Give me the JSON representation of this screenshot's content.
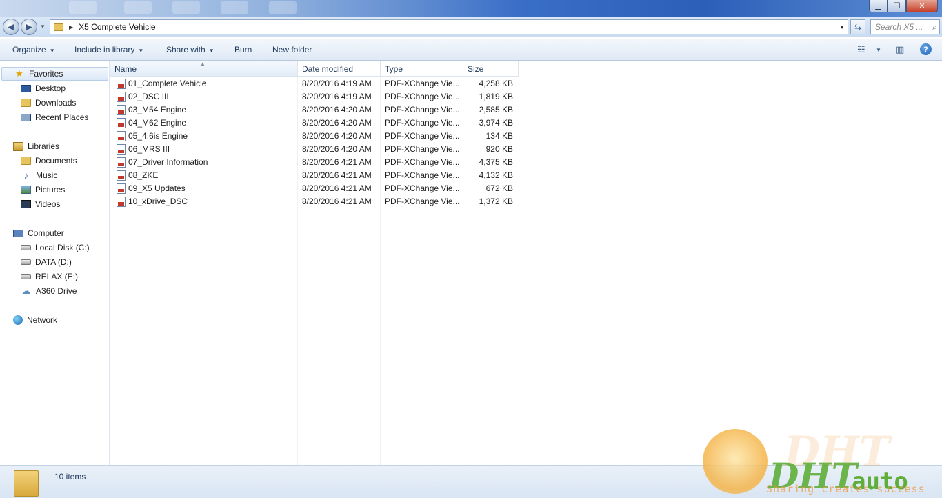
{
  "window": {
    "minimize_glyph": "▁",
    "maximize_glyph": "❐",
    "close_glyph": "✕"
  },
  "address": {
    "path": "X5 Complete Vehicle",
    "search_placeholder": "Search X5 ..."
  },
  "toolbar": {
    "organize": "Organize",
    "include_in_library": "Include in library",
    "share_with": "Share with",
    "burn": "Burn",
    "new_folder": "New folder",
    "help": "?"
  },
  "nav": {
    "favorites": "Favorites",
    "desktop": "Desktop",
    "downloads": "Downloads",
    "recent_places": "Recent Places",
    "libraries": "Libraries",
    "documents": "Documents",
    "music": "Music",
    "pictures": "Pictures",
    "videos": "Videos",
    "computer": "Computer",
    "local_disk": "Local Disk (C:)",
    "data_d": "DATA (D:)",
    "relax_e": "RELAX (E:)",
    "a360": "A360 Drive",
    "network": "Network"
  },
  "columns": {
    "name": "Name",
    "date_modified": "Date modified",
    "type": "Type",
    "size": "Size"
  },
  "files": [
    {
      "name": "01_Complete Vehicle",
      "date": "8/20/2016 4:19 AM",
      "type": "PDF-XChange Vie...",
      "size": "4,258 KB"
    },
    {
      "name": "02_DSC III",
      "date": "8/20/2016 4:19 AM",
      "type": "PDF-XChange Vie...",
      "size": "1,819 KB"
    },
    {
      "name": "03_M54 Engine",
      "date": "8/20/2016 4:20 AM",
      "type": "PDF-XChange Vie...",
      "size": "2,585 KB"
    },
    {
      "name": "04_M62 Engine",
      "date": "8/20/2016 4:20 AM",
      "type": "PDF-XChange Vie...",
      "size": "3,974 KB"
    },
    {
      "name": "05_4.6is Engine",
      "date": "8/20/2016 4:20 AM",
      "type": "PDF-XChange Vie...",
      "size": "134 KB"
    },
    {
      "name": "06_MRS III",
      "date": "8/20/2016 4:20 AM",
      "type": "PDF-XChange Vie...",
      "size": "920 KB"
    },
    {
      "name": "07_Driver Information",
      "date": "8/20/2016 4:21 AM",
      "type": "PDF-XChange Vie...",
      "size": "4,375 KB"
    },
    {
      "name": "08_ZKE",
      "date": "8/20/2016 4:21 AM",
      "type": "PDF-XChange Vie...",
      "size": "4,132 KB"
    },
    {
      "name": "09_X5 Updates",
      "date": "8/20/2016 4:21 AM",
      "type": "PDF-XChange Vie...",
      "size": "672 KB"
    },
    {
      "name": "10_xDrive_DSC",
      "date": "8/20/2016 4:21 AM",
      "type": "PDF-XChange Vie...",
      "size": "1,372 KB"
    }
  ],
  "status": {
    "item_count": "10 items"
  },
  "watermark": {
    "logo": "DHT",
    "suffix": "auto",
    "tagline": "Sharing creates success"
  }
}
